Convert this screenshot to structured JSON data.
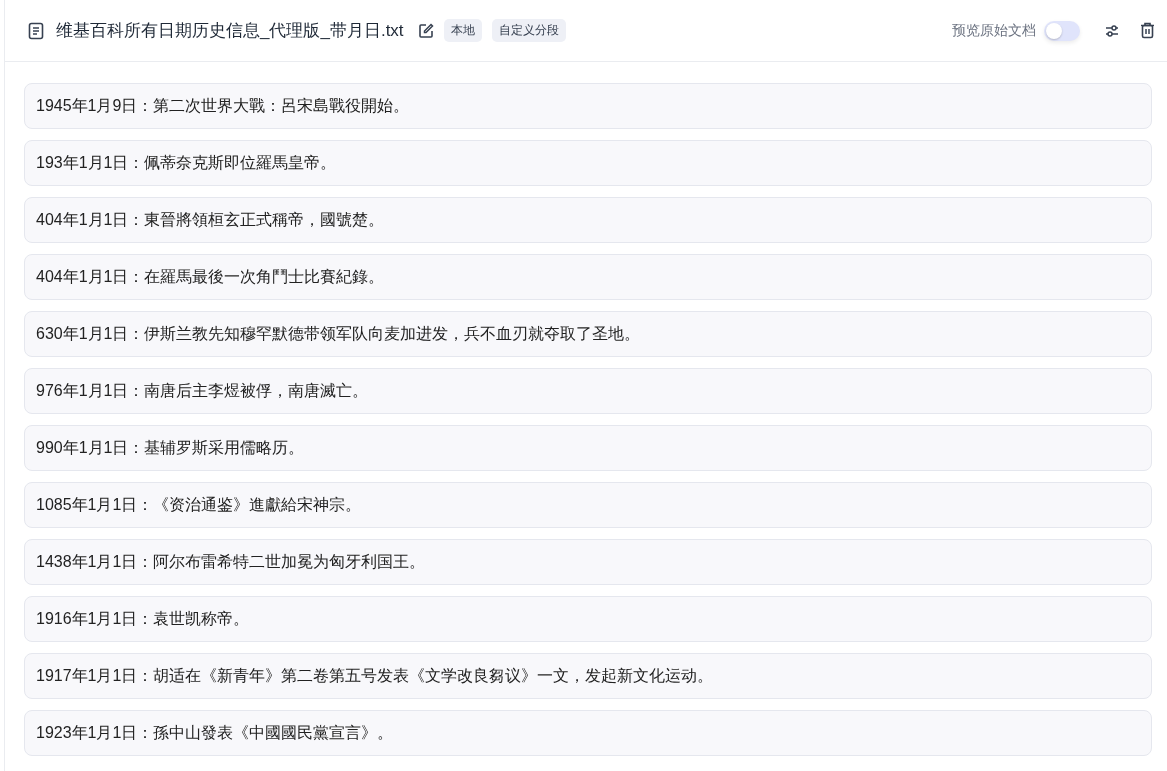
{
  "header": {
    "file_name": "维基百科所有日期历史信息_代理版_带月日.txt",
    "tags": [
      "本地",
      "自定义分段"
    ],
    "preview_label": "预览原始文档",
    "preview_toggle": {
      "on": false
    }
  },
  "segments": [
    {
      "text": "1945年1月9日：第二次世界大戰：呂宋島戰役開始。"
    },
    {
      "text": "193年1月1日：佩蒂奈克斯即位羅馬皇帝。"
    },
    {
      "text": "404年1月1日：東晉將領桓玄正式稱帝，國號楚。"
    },
    {
      "text": "404年1月1日：在羅馬最後一次角鬥士比賽紀錄。"
    },
    {
      "text": "630年1月1日：伊斯兰教先知穆罕默德带领军队向麦加进发，兵不血刃就夺取了圣地。"
    },
    {
      "text": "976年1月1日：南唐后主李煜被俘，南唐滅亡。"
    },
    {
      "text": "990年1月1日：基辅罗斯采用儒略历。"
    },
    {
      "text": "1085年1月1日：《资治通鉴》進獻給宋神宗。"
    },
    {
      "text": "1438年1月1日：阿尔布雷希特二世加冕为匈牙利国王。"
    },
    {
      "text": "1916年1月1日：袁世凯称帝。"
    },
    {
      "text": "1917年1月1日：胡适在《新青年》第二卷第五号发表《文学改良芻议》一文，发起新文化运动。"
    },
    {
      "text": "1923年1月1日：孫中山發表《中國國民黨宣言》。"
    }
  ]
}
